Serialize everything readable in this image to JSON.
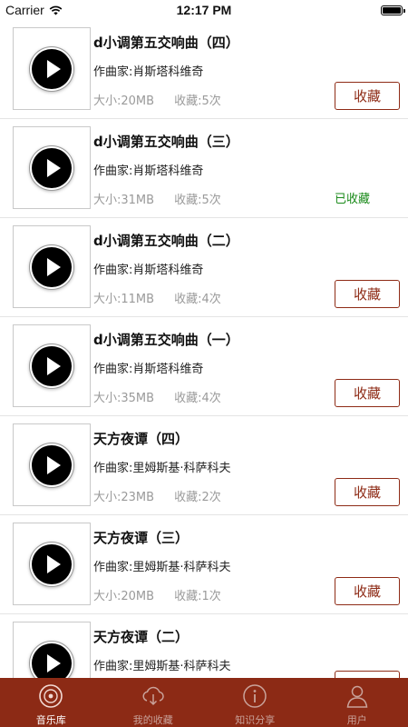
{
  "status_bar": {
    "carrier": "Carrier",
    "time": "12:17 PM",
    "battery_level": 1.0
  },
  "songs": [
    {
      "title": "d小调第五交响曲（四）",
      "composer": "作曲家:肖斯塔科维奇",
      "size": "大小:20MB",
      "favorites": "收藏:5次",
      "action": "收藏"
    },
    {
      "title": "d小调第五交响曲（三）",
      "composer": "作曲家:肖斯塔科维奇",
      "size": "大小:31MB",
      "favorites": "收藏:5次",
      "action": "已收藏"
    },
    {
      "title": "d小调第五交响曲（二）",
      "composer": "作曲家:肖斯塔科维奇",
      "size": "大小:11MB",
      "favorites": "收藏:4次",
      "action": "收藏"
    },
    {
      "title": "d小调第五交响曲（一）",
      "composer": "作曲家:肖斯塔科维奇",
      "size": "大小:35MB",
      "favorites": "收藏:4次",
      "action": "收藏"
    },
    {
      "title": "天方夜谭（四）",
      "composer": "作曲家:里姆斯基·科萨科夫",
      "size": "大小:23MB",
      "favorites": "收藏:2次",
      "action": "收藏"
    },
    {
      "title": "天方夜谭（三）",
      "composer": "作曲家:里姆斯基·科萨科夫",
      "size": "大小:20MB",
      "favorites": "收藏:1次",
      "action": "收藏"
    },
    {
      "title": "天方夜谭（二）",
      "composer": "作曲家:里姆斯基·科萨科夫",
      "size": "",
      "favorites": "",
      "action": ""
    }
  ],
  "tabs": [
    {
      "label": "音乐库",
      "icon": "music-library-icon",
      "active": true
    },
    {
      "label": "我的收藏",
      "icon": "cloud-download-icon",
      "active": false
    },
    {
      "label": "知识分享",
      "icon": "info-icon",
      "active": false
    },
    {
      "label": "用户",
      "icon": "user-icon",
      "active": false
    }
  ],
  "colors": {
    "brand": "#8c2a15",
    "favorited": "#1a8a1a",
    "muted": "#9a9a9a"
  }
}
